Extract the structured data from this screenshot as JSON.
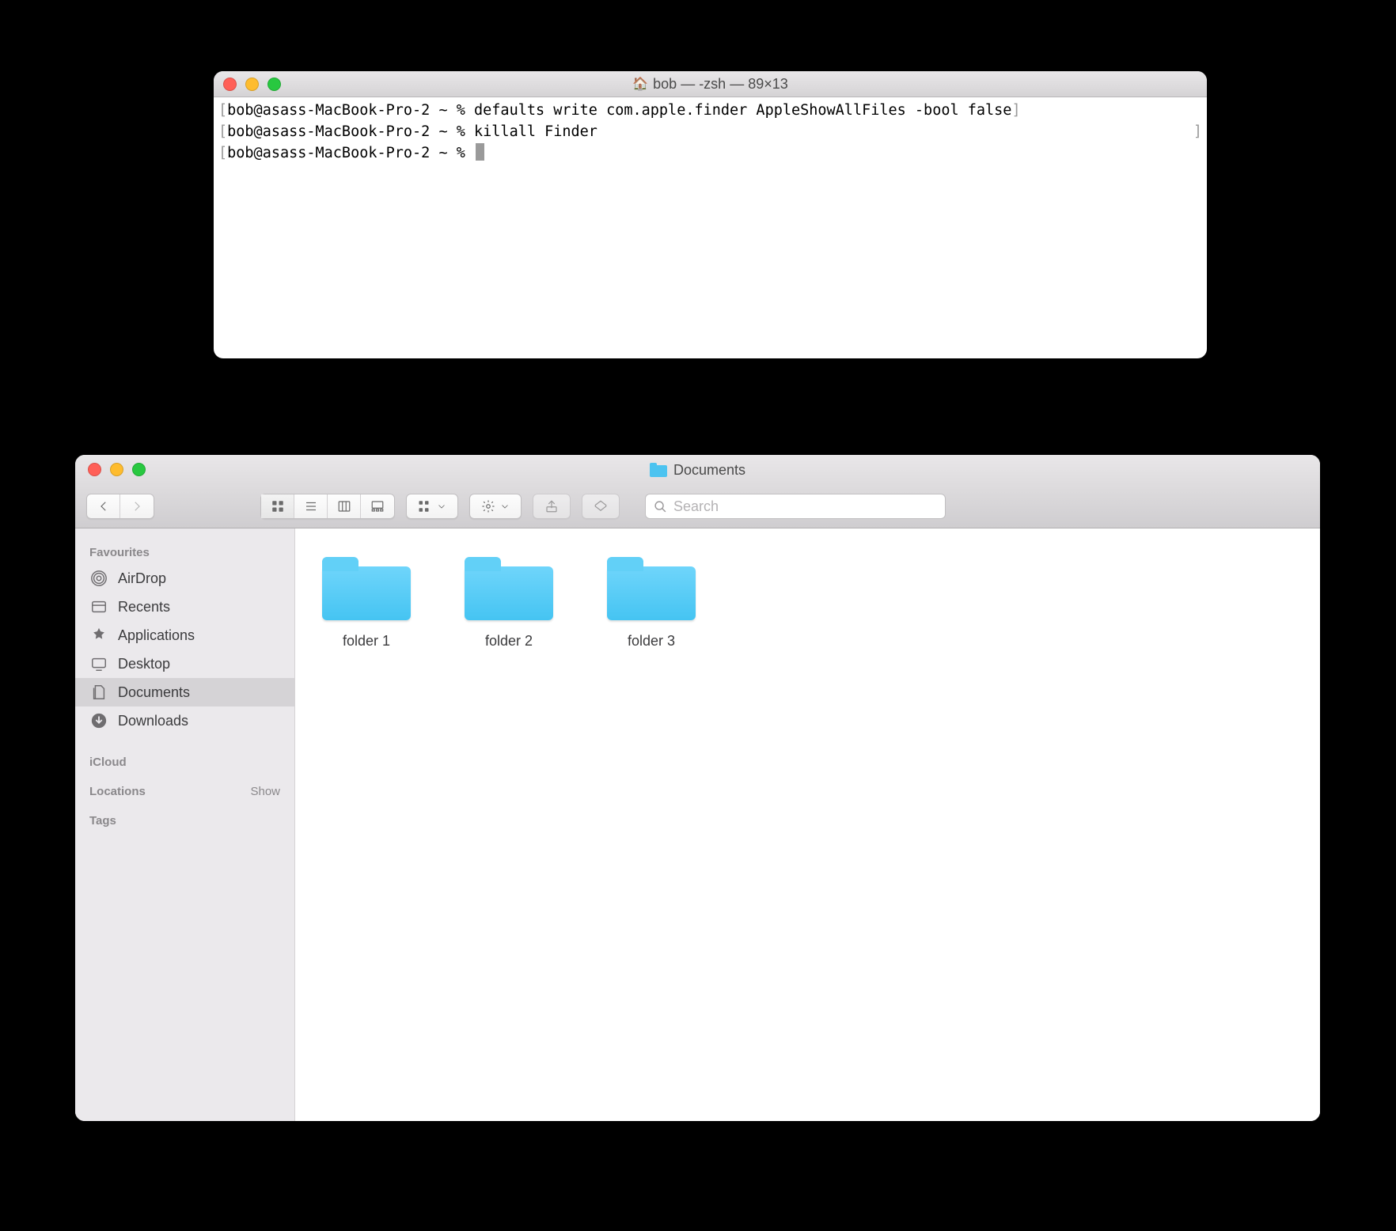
{
  "terminal": {
    "title": "bob — -zsh — 89×13",
    "prompt": "bob@asass-MacBook-Pro-2 ~ %",
    "lines": [
      {
        "cmd": "defaults write com.apple.finder AppleShowAllFiles -bool false"
      },
      {
        "cmd": "killall Finder"
      }
    ]
  },
  "finder": {
    "title": "Documents",
    "search_placeholder": "Search",
    "sidebar": {
      "favourites_label": "Favourites",
      "icloud_label": "iCloud",
      "locations_label": "Locations",
      "locations_show": "Show",
      "tags_label": "Tags",
      "items": [
        {
          "label": "AirDrop",
          "icon": "airdrop",
          "selected": false
        },
        {
          "label": "Recents",
          "icon": "recents",
          "selected": false
        },
        {
          "label": "Applications",
          "icon": "applications",
          "selected": false
        },
        {
          "label": "Desktop",
          "icon": "desktop",
          "selected": false
        },
        {
          "label": "Documents",
          "icon": "documents",
          "selected": true
        },
        {
          "label": "Downloads",
          "icon": "downloads",
          "selected": false
        }
      ]
    },
    "items": [
      {
        "label": "folder 1"
      },
      {
        "label": "folder 2"
      },
      {
        "label": "folder 3"
      }
    ]
  }
}
